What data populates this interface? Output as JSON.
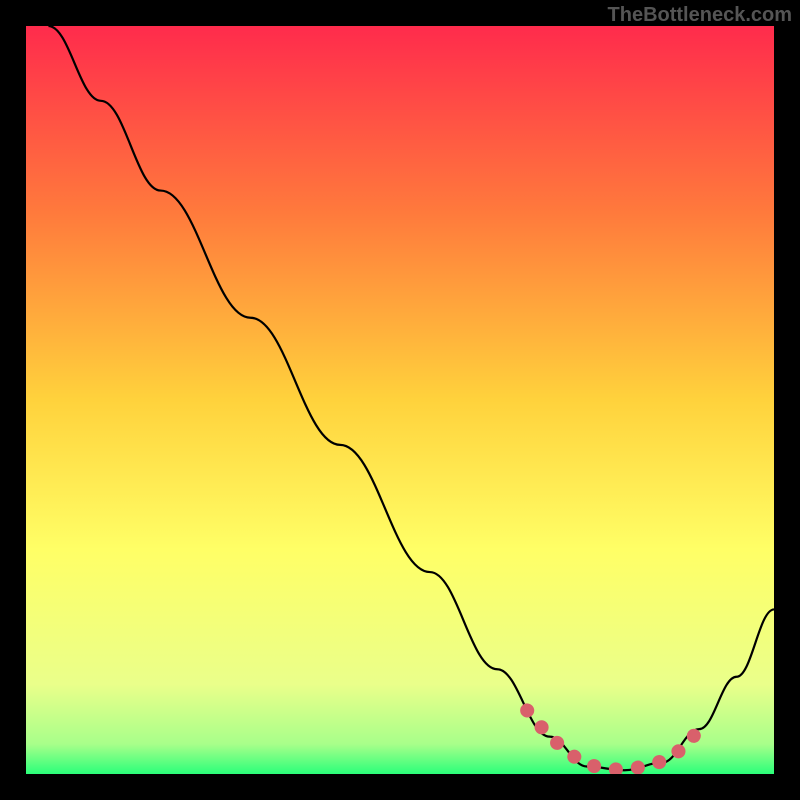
{
  "watermark": "TheBottleneck.com",
  "chart_data": {
    "type": "line",
    "title": "",
    "xlabel": "",
    "ylabel": "",
    "xlim": [
      0,
      100
    ],
    "ylim": [
      0,
      100
    ],
    "gradient_stops": [
      {
        "offset": 0,
        "color": "#ff2b4c"
      },
      {
        "offset": 25,
        "color": "#ff7a3c"
      },
      {
        "offset": 50,
        "color": "#ffd23c"
      },
      {
        "offset": 70,
        "color": "#ffff66"
      },
      {
        "offset": 88,
        "color": "#eaff8a"
      },
      {
        "offset": 96,
        "color": "#a8ff8a"
      },
      {
        "offset": 100,
        "color": "#2bff7a"
      }
    ],
    "series": [
      {
        "name": "curve",
        "color": "#000000",
        "points": [
          {
            "x": 3,
            "y": 100
          },
          {
            "x": 10,
            "y": 90
          },
          {
            "x": 18,
            "y": 78
          },
          {
            "x": 30,
            "y": 61
          },
          {
            "x": 42,
            "y": 44
          },
          {
            "x": 54,
            "y": 27
          },
          {
            "x": 63,
            "y": 14
          },
          {
            "x": 70,
            "y": 5
          },
          {
            "x": 75,
            "y": 1
          },
          {
            "x": 80,
            "y": 0.5
          },
          {
            "x": 85,
            "y": 1.5
          },
          {
            "x": 90,
            "y": 6
          },
          {
            "x": 95,
            "y": 13
          },
          {
            "x": 100,
            "y": 22
          }
        ]
      },
      {
        "name": "highlight-dots",
        "color": "#d9606b",
        "points": [
          {
            "x": 67,
            "y": 8.5
          },
          {
            "x": 70,
            "y": 5
          },
          {
            "x": 73,
            "y": 2.5
          },
          {
            "x": 75,
            "y": 1.3
          },
          {
            "x": 77,
            "y": 0.8
          },
          {
            "x": 79,
            "y": 0.6
          },
          {
            "x": 81,
            "y": 0.7
          },
          {
            "x": 83,
            "y": 1.1
          },
          {
            "x": 85,
            "y": 1.7
          },
          {
            "x": 88,
            "y": 3.5
          },
          {
            "x": 90,
            "y": 6
          }
        ]
      }
    ]
  }
}
